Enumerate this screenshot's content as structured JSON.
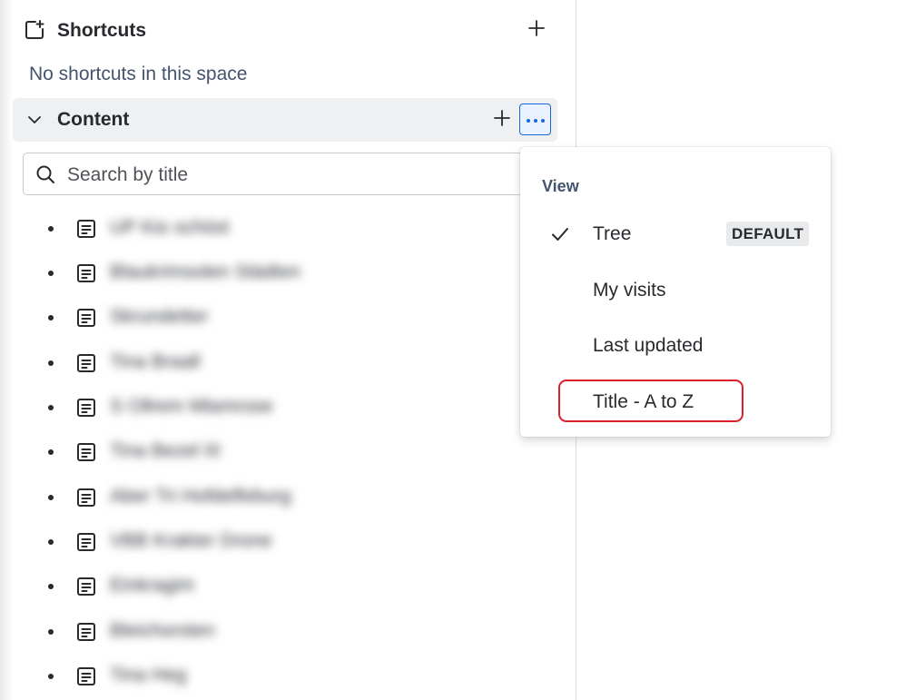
{
  "shortcuts": {
    "title": "Shortcuts",
    "empty_text": "No shortcuts in this space",
    "add_icon": "plus-icon"
  },
  "content": {
    "title": "Content",
    "add_icon": "plus-icon",
    "more_icon": "more-horizontal-icon"
  },
  "search": {
    "placeholder": "Search by title",
    "value": ""
  },
  "pages": [
    {
      "title": "UP Kio schöst"
    },
    {
      "title": "Blaukrimsolen Städten"
    },
    {
      "title": "Skrundetter"
    },
    {
      "title": "Tina Braall"
    },
    {
      "title": "S Ollrem Mlamrose"
    },
    {
      "title": "Tina Bezel III"
    },
    {
      "title": "Aber Tri Hofdelfeburg"
    },
    {
      "title": "VBB Krakter Drone"
    },
    {
      "title": "Einkragim"
    },
    {
      "title": "Bleichorsten"
    },
    {
      "title": "Tina Heg"
    }
  ],
  "view_menu": {
    "heading": "View",
    "items": [
      {
        "label": "Tree",
        "selected": true,
        "badge": "DEFAULT"
      },
      {
        "label": "My visits",
        "selected": false,
        "badge": ""
      },
      {
        "label": "Last updated",
        "selected": false,
        "badge": ""
      },
      {
        "label": "Title - A to Z",
        "selected": false,
        "badge": ""
      }
    ],
    "highlighted_item": "Title - A to Z"
  },
  "colors": {
    "accent": "#1868db",
    "highlight_annotation": "#dd1f2c",
    "content_row_bg": "#eff0f2"
  }
}
